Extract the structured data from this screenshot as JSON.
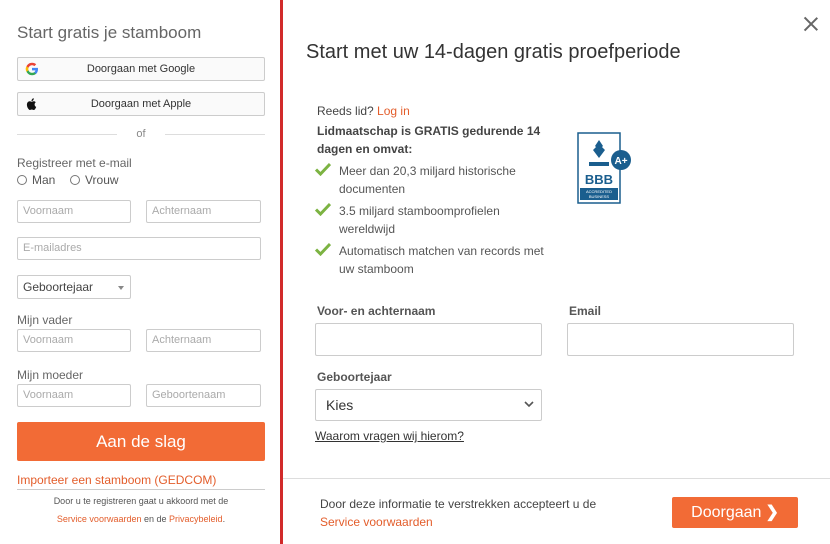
{
  "left": {
    "title": "Start gratis je stamboom",
    "google_label": "Doorgaan met Google",
    "apple_label": "Doorgaan met Apple",
    "or_text": "of",
    "register_label": "Registreer met e-mail",
    "gender_male": "Man",
    "gender_female": "Vrouw",
    "first_name_placeholder": "Voornaam",
    "last_name_placeholder": "Achternaam",
    "email_placeholder": "E-mailadres",
    "birth_year_select": "Geboortejaar",
    "father_label": "Mijn vader",
    "father_first_placeholder": "Voornaam",
    "father_last_placeholder": "Achternaam",
    "mother_label": "Mijn moeder",
    "mother_first_placeholder": "Voornaam",
    "mother_last_placeholder": "Geboortenaam",
    "start_button": "Aan de slag",
    "import_link": "Importeer een stamboom (GEDCOM)",
    "terms_prefix": "Door u te registreren gaat u akkoord met de",
    "terms_link": "Service voorwaarden",
    "terms_and": "en de",
    "privacy_link": "Privacybeleid",
    "terms_end": "."
  },
  "modal": {
    "title": "Start met uw 14-dagen gratis proefperiode",
    "member_prefix": "Reeds lid?",
    "login_link": "Log in",
    "offer": "Lidmaatschap is GRATIS gedurende 14 dagen en omvat:",
    "features": [
      "Meer dan 20,3 miljard historische documenten",
      "3.5 miljard stamboomprofielen wereldwijd",
      "Automatisch matchen van records met uw stamboom"
    ],
    "bbb_text": "BBB",
    "bbb_rating": "A+",
    "bbb_sub1": "ACCREDITED",
    "bbb_sub2": "BUSINESS",
    "name_label": "Voor- en achternaam",
    "email_label": "Email",
    "birth_year_label": "Geboortejaar",
    "birth_year_value": "Kies",
    "why_link": "Waarom vragen wij hierom?",
    "footer_text": "Door deze informatie te verstrekken accepteert u de",
    "footer_link": "Service voorwaarden",
    "continue_button": "Doorgaan",
    "continue_arrow": "❯"
  },
  "colors": {
    "accent": "#f26b36",
    "link": "#e35d2b",
    "divider": "#d12a2a",
    "check": "#7cb342",
    "bbb": "#1a5e8e"
  }
}
